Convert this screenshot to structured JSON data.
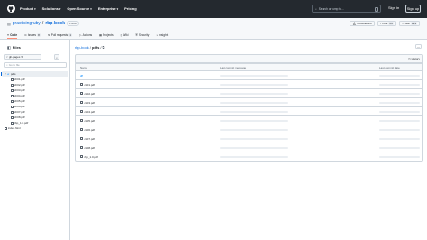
{
  "topbar": {
    "nav": [
      "Product",
      "Solutions",
      "Open Source",
      "Enterprise",
      "Pricing"
    ],
    "search_placeholder": "Search or jump to...",
    "search_key": "/",
    "signin": "Sign in",
    "signup": "Sign up"
  },
  "repo": {
    "owner": "practicingruby",
    "separator": "/",
    "name": "rbp-book",
    "visibility": "Public",
    "notifications_label": "Notifications",
    "fork_label": "Fork",
    "fork_count": "29",
    "star_label": "Star",
    "star_count": "133"
  },
  "tabs": [
    {
      "label": "Code",
      "count": ""
    },
    {
      "label": "Issues",
      "count": "8"
    },
    {
      "label": "Pull requests",
      "count": "1"
    },
    {
      "label": "Actions",
      "count": ""
    },
    {
      "label": "Projects",
      "count": ""
    },
    {
      "label": "Wiki",
      "count": ""
    },
    {
      "label": "Security",
      "count": ""
    },
    {
      "label": "Insights",
      "count": ""
    }
  ],
  "sidebar": {
    "title": "Files",
    "branch": "gh-pages",
    "goto_placeholder": "Go to file",
    "tree": [
      {
        "label": "pdfs",
        "type": "folder",
        "depth": 0
      },
      {
        "label": "ch01.pdf",
        "type": "file",
        "depth": 1
      },
      {
        "label": "ch02.pdf",
        "type": "file",
        "depth": 1
      },
      {
        "label": "ch03.pdf",
        "type": "file",
        "depth": 1
      },
      {
        "label": "ch04.pdf",
        "type": "file",
        "depth": 1
      },
      {
        "label": "ch05.pdf",
        "type": "file",
        "depth": 1
      },
      {
        "label": "ch06.pdf",
        "type": "file",
        "depth": 1
      },
      {
        "label": "ch07.pdf",
        "type": "file",
        "depth": 1
      },
      {
        "label": "ch08.pdf",
        "type": "file",
        "depth": 1
      },
      {
        "label": "rbp_1.0.pdf",
        "type": "file",
        "depth": 1
      },
      {
        "label": "index.html",
        "type": "file",
        "depth": 0
      }
    ]
  },
  "breadcrumb": {
    "repo": "rbp-book",
    "sep1": "/",
    "folder": "pdfs",
    "sep2": "/"
  },
  "history_label": "History",
  "table": {
    "headers": {
      "name": "Name",
      "message": "Last commit message",
      "date": "Last commit date"
    },
    "rows": [
      {
        "name": "..",
        "type": "parent"
      },
      {
        "name": "ch01.pdf",
        "type": "file"
      },
      {
        "name": "ch02.pdf",
        "type": "file"
      },
      {
        "name": "ch03.pdf",
        "type": "file"
      },
      {
        "name": "ch04.pdf",
        "type": "file"
      },
      {
        "name": "ch05.pdf",
        "type": "file"
      },
      {
        "name": "ch06.pdf",
        "type": "file"
      },
      {
        "name": "ch07.pdf",
        "type": "file"
      },
      {
        "name": "ch08.pdf",
        "type": "file"
      },
      {
        "name": "rbp_1.0.pdf",
        "type": "file"
      }
    ]
  }
}
